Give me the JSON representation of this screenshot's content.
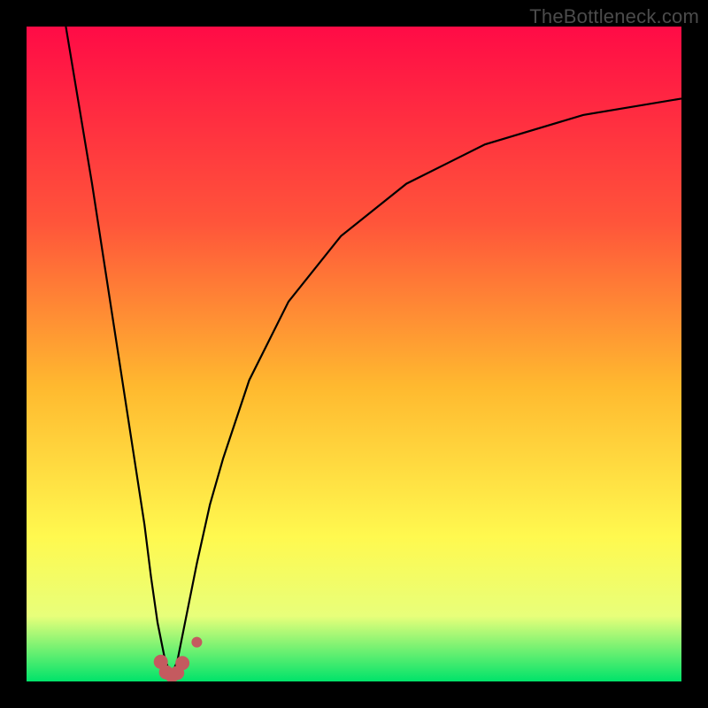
{
  "watermark": "TheBottleneck.com",
  "colors": {
    "frame_bg": "#000000",
    "gradient_top": "#ff0b46",
    "gradient_mid1": "#ff553a",
    "gradient_mid2": "#ffb92f",
    "gradient_mid3": "#fff94f",
    "gradient_mid4": "#e8ff7a",
    "gradient_bottom": "#00e36a",
    "curve": "#000000",
    "markers": "#c45a5f",
    "watermark": "#4b4b4b"
  },
  "chart_data": {
    "type": "line",
    "title": "",
    "xlabel": "",
    "ylabel": "",
    "x_range": [
      0,
      100
    ],
    "y_range": [
      0,
      100
    ],
    "optimal_x": 22,
    "curve_left_samples": [
      [
        6,
        100
      ],
      [
        8,
        88
      ],
      [
        10,
        76
      ],
      [
        12,
        63
      ],
      [
        14,
        50
      ],
      [
        16,
        37
      ],
      [
        18,
        24
      ],
      [
        19,
        16
      ],
      [
        20,
        9
      ],
      [
        21,
        4
      ],
      [
        22,
        0.8
      ]
    ],
    "curve_right_samples": [
      [
        22,
        0.8
      ],
      [
        23,
        3
      ],
      [
        24,
        8
      ],
      [
        26,
        18
      ],
      [
        28,
        27
      ],
      [
        30,
        34
      ],
      [
        34,
        46
      ],
      [
        40,
        58
      ],
      [
        48,
        68
      ],
      [
        58,
        76
      ],
      [
        70,
        82
      ],
      [
        85,
        86.5
      ],
      [
        100,
        89
      ]
    ],
    "markers": [
      {
        "x": 20.5,
        "y": 3,
        "r": 8
      },
      {
        "x": 21.3,
        "y": 1.4,
        "r": 8
      },
      {
        "x": 22.2,
        "y": 0.9,
        "r": 8
      },
      {
        "x": 23.0,
        "y": 1.3,
        "r": 8
      },
      {
        "x": 23.8,
        "y": 2.8,
        "r": 8
      },
      {
        "x": 26.0,
        "y": 6.0,
        "r": 6
      }
    ],
    "gradient_stops": [
      {
        "pct": 0,
        "key": "gradient_top"
      },
      {
        "pct": 30,
        "key": "gradient_mid1"
      },
      {
        "pct": 55,
        "key": "gradient_mid2"
      },
      {
        "pct": 78,
        "key": "gradient_mid3"
      },
      {
        "pct": 90,
        "key": "gradient_mid4"
      },
      {
        "pct": 100,
        "key": "gradient_bottom"
      }
    ]
  }
}
